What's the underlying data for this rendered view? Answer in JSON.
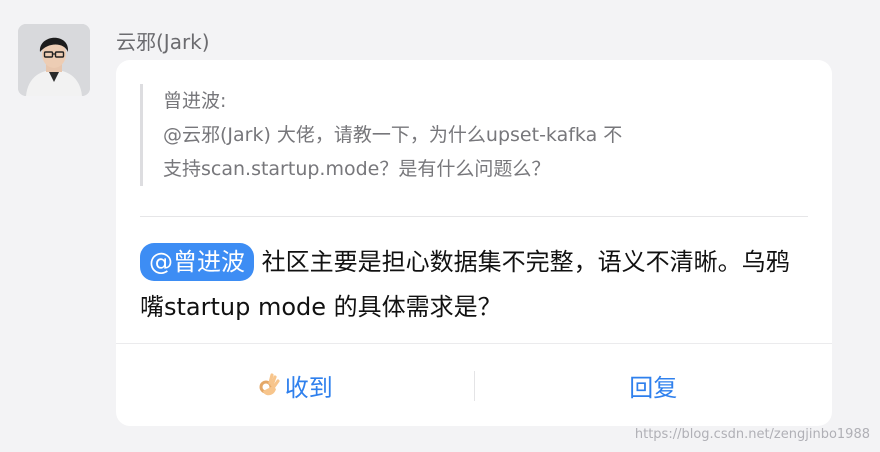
{
  "message": {
    "sender_name": "云邪(Jark)",
    "avatar_icon": "user-avatar-icon",
    "quote": {
      "author": "曾进波:",
      "line1": "@云邪(Jark)  大佬，请教一下，为什么upset-kafka 不",
      "line2": "支持scan.startup.mode？是有什么问题么？"
    },
    "mention": "@曾进波",
    "text": " 社区主要是担心数据集不完整，语义不清晰。乌鸦嘴startup mode 的具体需求是？"
  },
  "actions": {
    "ack_icon": "ok-hand-icon",
    "ack_label": "收到",
    "reply_label": "回复"
  },
  "watermark": "https://blog.csdn.net/zengjinbo1988",
  "colors": {
    "accent": "#3d8df4",
    "action_text": "#2f80ed",
    "background": "#f3f3f5"
  }
}
